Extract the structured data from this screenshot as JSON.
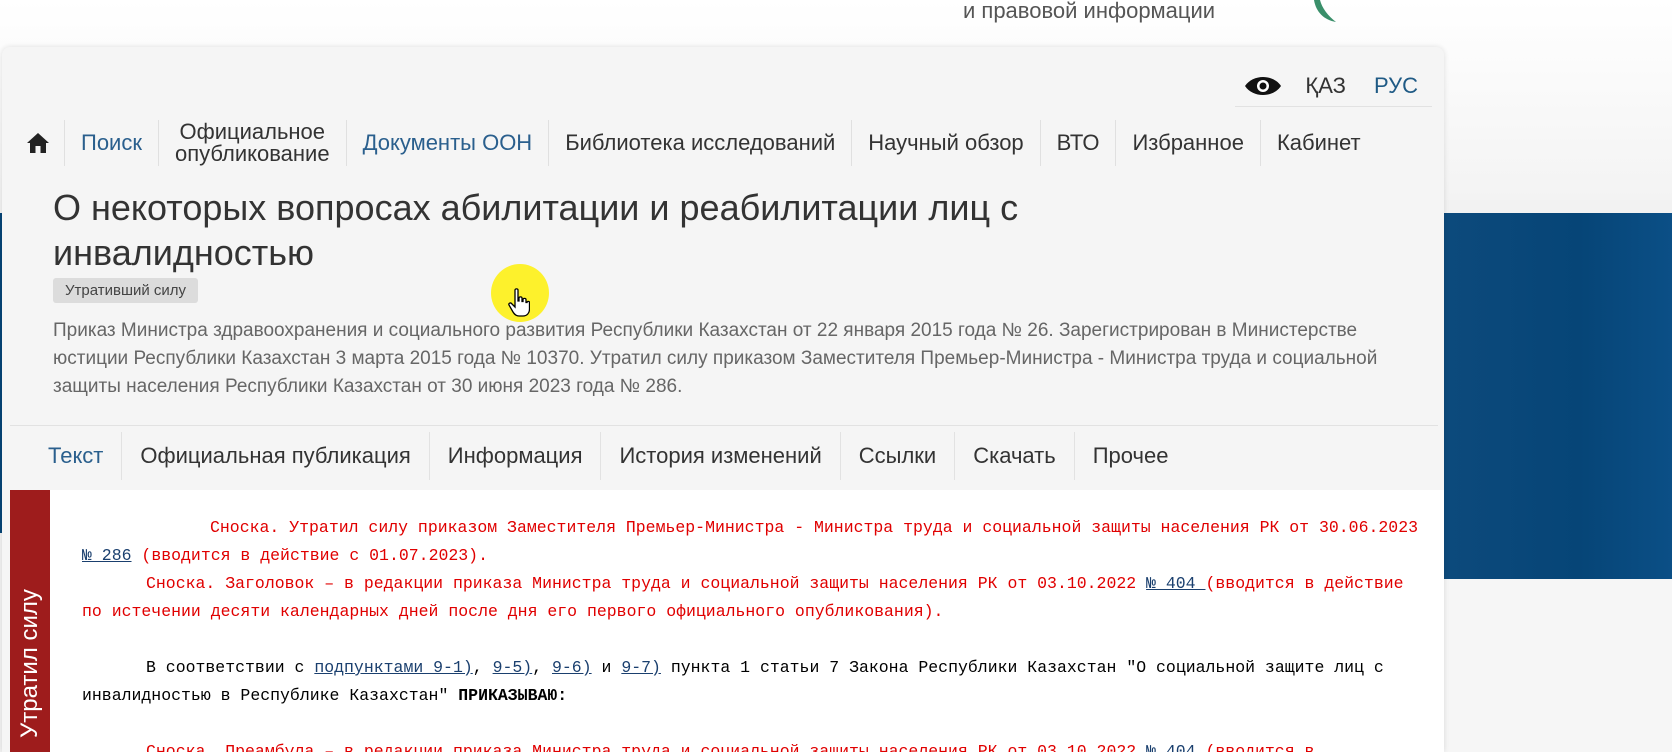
{
  "header": {
    "info_text": "и правовой информации"
  },
  "lang_bar": {
    "eye_icon": "eye-icon",
    "kaz": "ҚАЗ",
    "rus": "РУС"
  },
  "nav": {
    "home_icon": "home-icon",
    "search": "Поиск",
    "official_line1": "Официальное",
    "official_line2": "опубликование",
    "un_docs": "Документы ООН",
    "library": "Библиотека исследований",
    "review": "Научный обзор",
    "wto": "ВТО",
    "favorites": "Избранное",
    "cabinet": "Кабинет"
  },
  "document": {
    "title": "О некоторых вопросах абилитации и реабилитации лиц с инвалидностью",
    "status": "Утративший силу",
    "description": "Приказ Министра здравоохранения и социального развития Республики Казахстан от 22 января 2015 года № 26. Зарегистрирован в Министерстве юстиции Республики Казахстан 3 марта 2015 года № 10370. Утратил силу приказом Заместителя Премьер-Министра - Министра труда и социальной защиты населения Республики Казахстан от 30 июня 2023 года № 286."
  },
  "tabs": {
    "text": "Текст",
    "official_pub": "Официальная публикация",
    "info": "Информация",
    "history": "История изменений",
    "links": "Ссылки",
    "download": "Скачать",
    "other": "Прочее"
  },
  "ribbon": {
    "label": "Утратил силу"
  },
  "body": {
    "note1_text": "Сноска. Утратил силу приказом Заместителя Премьер-Министра - Министра труда и социальной защиты населения РК от 30.06.2023 ",
    "note1_link": "№ 286",
    "note1_tail": " (вводится в действие с 01.07.2023).",
    "note2_text": "Сноска. Заголовок – в редакции приказа Министра труда и социальной защиты населения РК от 03.10.2022 ",
    "note2_link": "№ 404 ",
    "note2_tail": "(вводится в действие по истечении десяти календарных дней после дня его первого официального опубликования).",
    "para_start": "В соответствии с ",
    "link_9_1": "подпунктами 9-1)",
    "sep1": ", ",
    "link_9_5": "9-5)",
    "sep2": ", ",
    "link_9_6": "9-6)",
    "sep3": " и ",
    "link_9_7": "9-7)",
    "para_mid": " пункта 1 статьи 7 Закона Республики Казахстан \"О социальной защите лиц с инвалидностью в Республике Казахстан\" ",
    "para_bold": "ПРИКАЗЫВАЮ:",
    "note3_text": "Сноска. Преамбула – в редакции приказа Министра труда и социальной защиты населения РК от 03.10.2022 ",
    "note3_link": "№ 404",
    "note3_tail": " (вводится в"
  },
  "colors": {
    "link": "#2a5f8d",
    "note_red": "#e00000",
    "ribbon": "#9e1c1c",
    "brand_blue": "#064577"
  }
}
